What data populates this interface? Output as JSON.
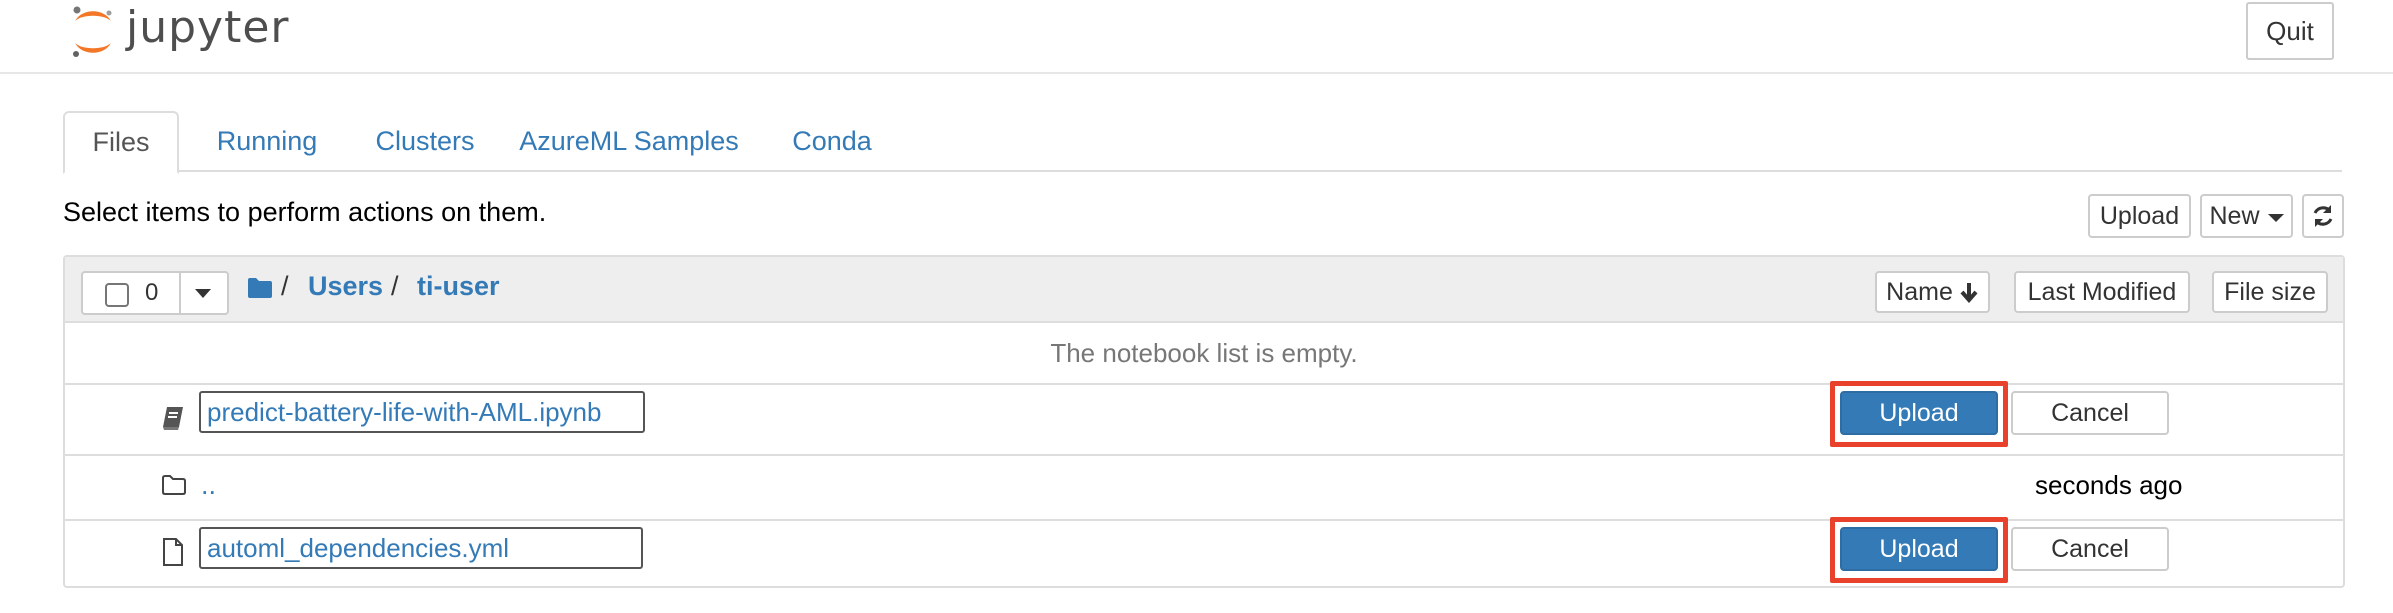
{
  "header": {
    "logo_text": "jupyter",
    "quit_label": "Quit"
  },
  "tabs": [
    {
      "label": "Files",
      "active": true
    },
    {
      "label": "Running",
      "active": false
    },
    {
      "label": "Clusters",
      "active": false
    },
    {
      "label": "AzureML Samples",
      "active": false
    },
    {
      "label": "Conda",
      "active": false
    }
  ],
  "toolbar": {
    "instructions": "Select items to perform actions on them.",
    "upload_label": "Upload",
    "new_label": "New",
    "refresh_icon": "refresh-icon"
  },
  "list_header": {
    "selected_count": "0",
    "breadcrumb": {
      "root_icon": "folder-icon",
      "sep1": "/",
      "item1": "Users",
      "sep2": "/",
      "item2": "ti-user"
    },
    "sort_name_label": "Name",
    "sort_modified_label": "Last Modified",
    "sort_size_label": "File size"
  },
  "list": {
    "empty_message": "The notebook list is empty.",
    "rows": [
      {
        "type": "notebook",
        "icon": "notebook-icon",
        "name": "predict-battery-life-with-AML.ipynb",
        "upload_label": "Upload",
        "cancel_label": "Cancel"
      },
      {
        "type": "folder",
        "icon": "folder-outline-icon",
        "name": "..",
        "modified": "seconds ago"
      },
      {
        "type": "file",
        "icon": "file-icon",
        "name": "automl_dependencies.yml",
        "upload_label": "Upload",
        "cancel_label": "Cancel"
      }
    ]
  },
  "colors": {
    "link": "#337ab7",
    "primary": "#337ab7",
    "highlight": "#e8412c",
    "logo_orange": "#f37726"
  }
}
